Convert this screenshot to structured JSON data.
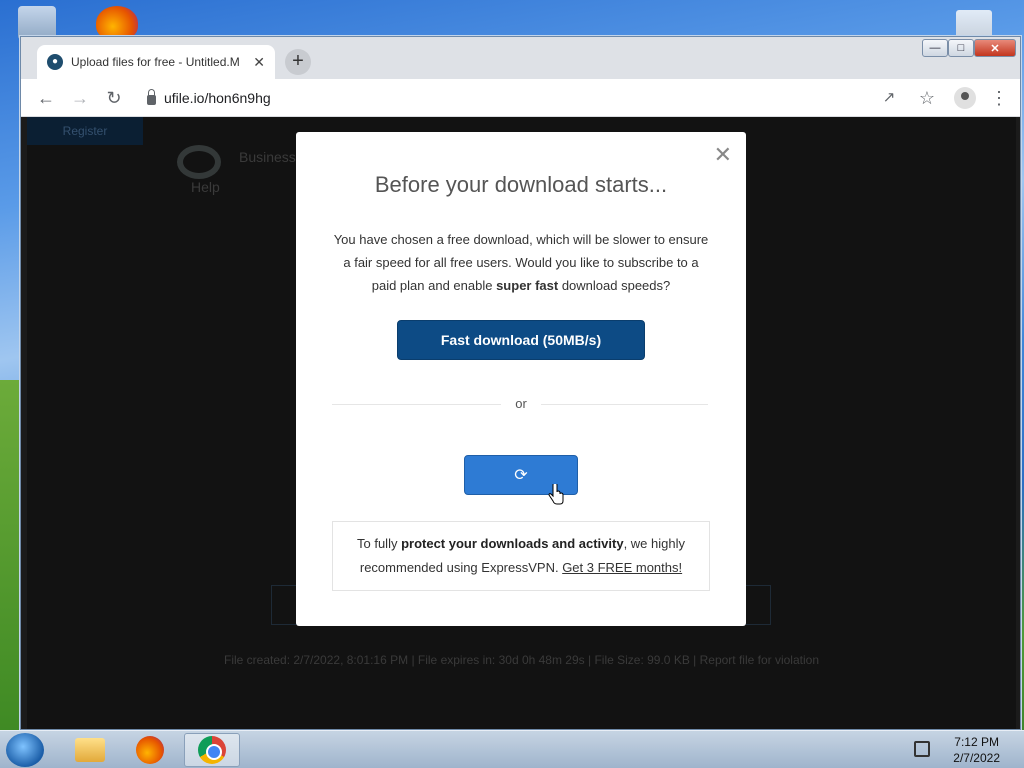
{
  "browser": {
    "tab_title": "Upload files for free - Untitled.M",
    "new_tab_label": "+",
    "url": "ufile.io/hon6n9hg"
  },
  "background_page": {
    "logo_text": "Business",
    "help_label": "Help",
    "register_label": "Register",
    "footer": "File created: 2/7/2022, 8:01:16 PM  |  File expires in: 30d 0h 48m 29s  |  File Size: 99.0 KB  |  Report file for violation"
  },
  "modal": {
    "title": "Before your download starts...",
    "body_prefix": "You have chosen a free download, which will be slower to ensure a fair speed for all free users. Would you like to subscribe to a paid plan and enable ",
    "body_bold": "super fast",
    "body_suffix": " download speeds?",
    "fast_button": "Fast download (50MB/s)",
    "or_label": "or",
    "vpn_prefix": "To fully ",
    "vpn_bold": "protect your downloads and activity",
    "vpn_middle": ", we highly recommended using ExpressVPN. ",
    "vpn_link": "Get 3 FREE months!"
  },
  "taskbar": {
    "time": "7:12 PM",
    "date": "2/7/2022"
  },
  "icons": {
    "close": "close-icon",
    "refresh": "refresh-icon",
    "cursor": "hand-cursor-icon"
  }
}
